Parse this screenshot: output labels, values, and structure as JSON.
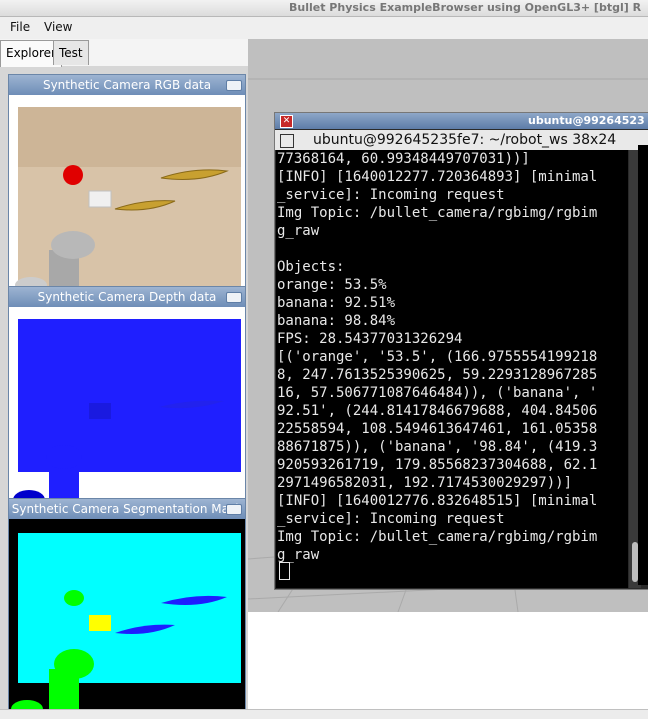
{
  "window": {
    "title": "Bullet Physics ExampleBrowser using OpenGL3+ [btgl] R"
  },
  "menu": {
    "file": "File",
    "view": "View"
  },
  "tabs": {
    "explorer": "Explorer",
    "test": "Test"
  },
  "cameras": {
    "rgb": "Synthetic Camera RGB data",
    "depth": "Synthetic Camera Depth data",
    "seg": "Synthetic Camera Segmentation Mask"
  },
  "terminal": {
    "window_title": "ubuntu@99264523",
    "tab_title": "ubuntu@992645235fe7: ~/robot_ws 38x24",
    "lines": [
      "77368164, 60.99348449707031))]",
      "[INFO] [1640012277.720364893] [minimal",
      "_service]: Incoming request",
      "Img Topic: /bullet_camera/rgbimg/rgbim",
      "g_raw",
      "",
      "Objects:",
      "orange: 53.5%",
      "banana: 92.51%",
      "banana: 98.84%",
      "FPS: 28.54377031326294",
      "[('orange', '53.5', (166.9755554199218",
      "8, 247.7613525390625, 59.2293128967285",
      "16, 57.506771087646484)), ('banana', '",
      "92.51', (244.81417846679688, 404.84506",
      "22558594, 108.5494613647461, 161.05358",
      "88671875)), ('banana', '98.84', (419.3",
      "920593261719, 179.85568237304688, 62.1",
      "2971496582031, 192.7174530029297))]",
      "[INFO] [1640012776.832648515] [minimal",
      "_service]: Incoming request",
      "Img Topic: /bullet_camera/rgbimg/rgbim",
      "g_raw"
    ]
  },
  "colors": {
    "rgb_bg": "#d8c3a8",
    "depth_blue": "#1f1fff",
    "seg_cyan": "#00ffff",
    "seg_green": "#00ff00",
    "seg_blue": "#1e1eff",
    "seg_yellow": "#ffff00",
    "orange_ball": "#e00000",
    "banana": "#c8a030"
  }
}
